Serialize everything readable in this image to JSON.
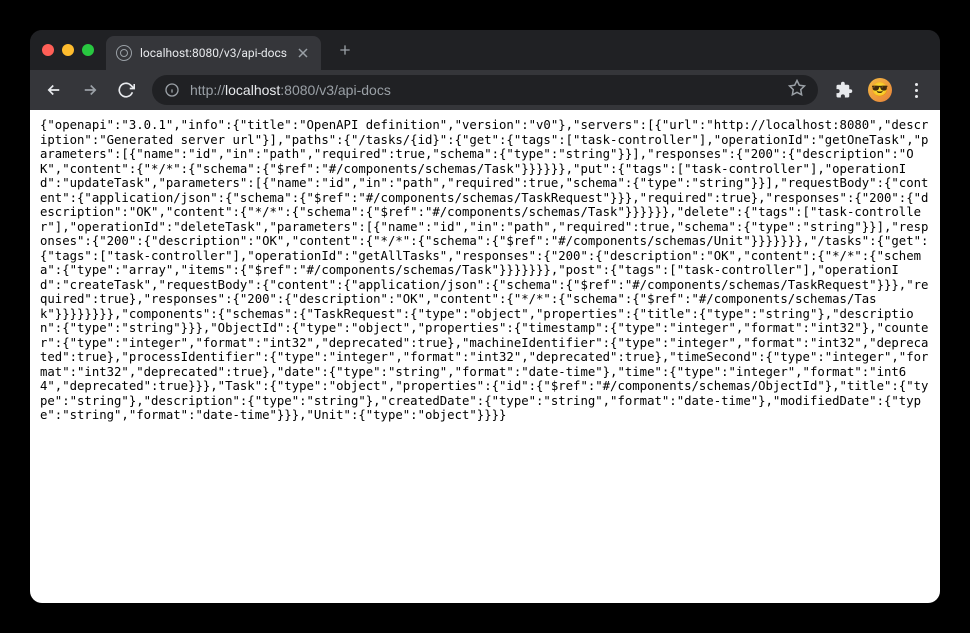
{
  "tab": {
    "title": "localhost:8080/v3/api-docs"
  },
  "addressbar": {
    "protocol": "http://",
    "host": "localhost",
    "port_path": ":8080/v3/api-docs"
  },
  "response_body": "{\"openapi\":\"3.0.1\",\"info\":{\"title\":\"OpenAPI definition\",\"version\":\"v0\"},\"servers\":[{\"url\":\"http://localhost:8080\",\"description\":\"Generated server url\"}],\"paths\":{\"/tasks/{id}\":{\"get\":{\"tags\":[\"task-controller\"],\"operationId\":\"getOneTask\",\"parameters\":[{\"name\":\"id\",\"in\":\"path\",\"required\":true,\"schema\":{\"type\":\"string\"}}],\"responses\":{\"200\":{\"description\":\"OK\",\"content\":{\"*/*\":{\"schema\":{\"$ref\":\"#/components/schemas/Task\"}}}}}},\"put\":{\"tags\":[\"task-controller\"],\"operationId\":\"updateTask\",\"parameters\":[{\"name\":\"id\",\"in\":\"path\",\"required\":true,\"schema\":{\"type\":\"string\"}}],\"requestBody\":{\"content\":{\"application/json\":{\"schema\":{\"$ref\":\"#/components/schemas/TaskRequest\"}}},\"required\":true},\"responses\":{\"200\":{\"description\":\"OK\",\"content\":{\"*/*\":{\"schema\":{\"$ref\":\"#/components/schemas/Task\"}}}}}},\"delete\":{\"tags\":[\"task-controller\"],\"operationId\":\"deleteTask\",\"parameters\":[{\"name\":\"id\",\"in\":\"path\",\"required\":true,\"schema\":{\"type\":\"string\"}}],\"responses\":{\"200\":{\"description\":\"OK\",\"content\":{\"*/*\":{\"schema\":{\"$ref\":\"#/components/schemas/Unit\"}}}}}}},\"/tasks\":{\"get\":{\"tags\":[\"task-controller\"],\"operationId\":\"getAllTasks\",\"responses\":{\"200\":{\"description\":\"OK\",\"content\":{\"*/*\":{\"schema\":{\"type\":\"array\",\"items\":{\"$ref\":\"#/components/schemas/Task\"}}}}}}},\"post\":{\"tags\":[\"task-controller\"],\"operationId\":\"createTask\",\"requestBody\":{\"content\":{\"application/json\":{\"schema\":{\"$ref\":\"#/components/schemas/TaskRequest\"}}},\"required\":true},\"responses\":{\"200\":{\"description\":\"OK\",\"content\":{\"*/*\":{\"schema\":{\"$ref\":\"#/components/schemas/Task\"}}}}}}}},\"components\":{\"schemas\":{\"TaskRequest\":{\"type\":\"object\",\"properties\":{\"title\":{\"type\":\"string\"},\"description\":{\"type\":\"string\"}}},\"ObjectId\":{\"type\":\"object\",\"properties\":{\"timestamp\":{\"type\":\"integer\",\"format\":\"int32\"},\"counter\":{\"type\":\"integer\",\"format\":\"int32\",\"deprecated\":true},\"machineIdentifier\":{\"type\":\"integer\",\"format\":\"int32\",\"deprecated\":true},\"processIdentifier\":{\"type\":\"integer\",\"format\":\"int32\",\"deprecated\":true},\"timeSecond\":{\"type\":\"integer\",\"format\":\"int32\",\"deprecated\":true},\"date\":{\"type\":\"string\",\"format\":\"date-time\"},\"time\":{\"type\":\"integer\",\"format\":\"int64\",\"deprecated\":true}}},\"Task\":{\"type\":\"object\",\"properties\":{\"id\":{\"$ref\":\"#/components/schemas/ObjectId\"},\"title\":{\"type\":\"string\"},\"description\":{\"type\":\"string\"},\"createdDate\":{\"type\":\"string\",\"format\":\"date-time\"},\"modifiedDate\":{\"type\":\"string\",\"format\":\"date-time\"}}},\"Unit\":{\"type\":\"object\"}}}}"
}
